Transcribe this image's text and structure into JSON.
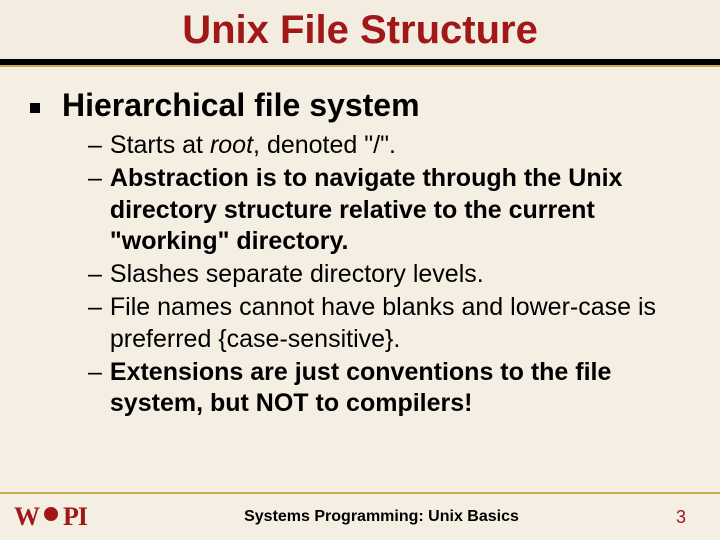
{
  "title": "Unix File Structure",
  "main_bullet": "Hierarchical file system",
  "sub_items": [
    {
      "prefix": "Starts at ",
      "italic": "root",
      "rest": ", denoted \"/\"."
    },
    {
      "bold_all": true,
      "text": "Abstraction is to navigate through the Unix directory structure relative to the current \"working\" directory."
    },
    {
      "text": "Slashes separate directory levels."
    },
    {
      "text": "File names cannot have blanks and lower-case is preferred {case-sensitive}."
    },
    {
      "bold_all": true,
      "text": "Extensions are just conventions to the file system, but NOT to compilers!"
    }
  ],
  "footer": {
    "logo_text_left": "W",
    "logo_text_right": "PI",
    "center": "Systems Programming:  Unix Basics",
    "page": "3"
  }
}
